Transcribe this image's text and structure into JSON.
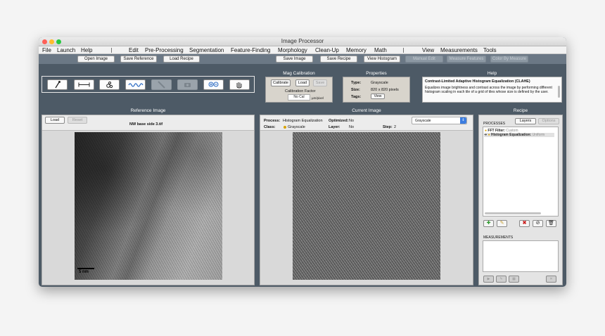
{
  "window": {
    "title": "Image Processor",
    "traffic_lights": {
      "close": "#fe5f57",
      "minimize": "#febc2e",
      "zoom": "#28c840"
    }
  },
  "menubar": {
    "items": [
      "File",
      "Launch",
      "Help",
      "Edit",
      "Pre-Processing",
      "Segmentation",
      "Feature-Finding",
      "Morphology",
      "Clean-Up",
      "Memory",
      "Math",
      "View",
      "Measurements",
      "Tools"
    ]
  },
  "toolbar": {
    "open_image": "Open Image",
    "save_reference": "Save Reference",
    "load_recipe": "Load Recipe",
    "save_image": "Save Image",
    "save_recipe": "Save Recipe",
    "view_histogram": "View Histogram",
    "manual_edit": "Manual Edit",
    "measure_features": "Measure Features",
    "color_by_measure": "Color By Measure"
  },
  "tools": [
    "eyedropper-icon",
    "measure-line-icon",
    "particle-icon",
    "wave-profile-icon",
    "line-tool-icon",
    "camera-icon",
    "zoom-icon",
    "pan-hand-icon"
  ],
  "mag_calibration": {
    "title": "Mag Calibration",
    "calibrate": "Calibrate",
    "load": "Load",
    "save": "Save",
    "factor_label": "Calibration Factor",
    "factor_value": "No Cal",
    "unit": "µm/pixel"
  },
  "properties": {
    "title": "Properties",
    "type_label": "Type:",
    "type_value": "Grayscale",
    "size_label": "Size:",
    "size_value": "820 x 820 pixels",
    "tags_label": "Tags:",
    "tags_button": "View"
  },
  "help": {
    "title": "Help",
    "heading": "Contrast-Limited Adaptive Histogram Equalization (CLAHE)",
    "body": "Equalizes image brightness and contrast across the image by performing different histogram scaling in each tile of a grid of tiles whose size is defined by the user."
  },
  "reference": {
    "title": "Reference Image",
    "load": "Load",
    "reset": "Reset",
    "filename": "NW base side 3.tif",
    "scale_bar": "5 nm"
  },
  "current": {
    "title": "Current Image",
    "process_label": "Process:",
    "process_value": "Histogram Equalization",
    "optimized_label": "Optimized:",
    "optimized_value": "No",
    "class_label": "Class:",
    "class_value": "Grayscale",
    "layer_label": "Layer:",
    "layer_value": "No",
    "step_label": "Step:",
    "step_value": "2",
    "color_mode": "Grayscale"
  },
  "recipe": {
    "title": "Recipe",
    "tab_layers": "Layers",
    "tab_other": "Options",
    "processes_label": "PROCESSES",
    "items": [
      {
        "name": "FFT Filter:",
        "detail": "Custom"
      },
      {
        "name": "Histogram Equalization:",
        "detail": "Uniform"
      }
    ],
    "measurements_label": "MEASUREMENTS"
  },
  "colors": {
    "window_bg": "#4d5a66",
    "toolbar_bg": "#6b7885",
    "panel_bg": "#d8d4cc",
    "delete_red": "#cc2222",
    "add_green": "#2a9a2a"
  }
}
